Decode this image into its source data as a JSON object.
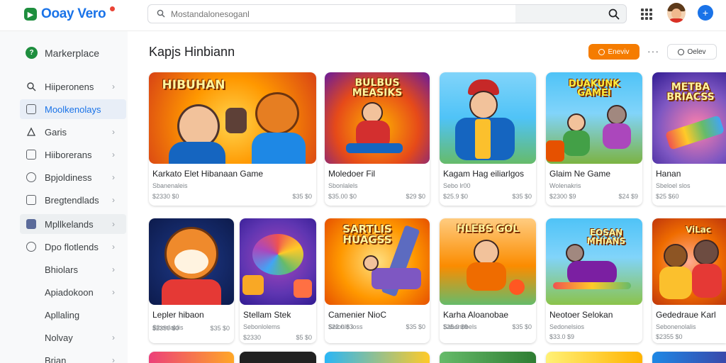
{
  "app": {
    "logo_text": "Ooay Vero",
    "search_placeholder": "Mostandalonesoganl"
  },
  "sidebar": {
    "header": "Markerplace",
    "items": [
      {
        "label": "Hiiperonens",
        "icon": "search-icon",
        "chevron": true
      },
      {
        "label": "Moolkenolays",
        "icon": "marketplace-icon",
        "chevron": false
      },
      {
        "label": "Garis",
        "icon": "games-icon",
        "chevron": true
      },
      {
        "label": "Hiiborerans",
        "icon": "chart-icon",
        "chevron": true
      },
      {
        "label": "Bpjoldiness",
        "icon": "coin-icon",
        "chevron": true
      },
      {
        "label": "Bregtendlads",
        "icon": "list-icon",
        "chevron": true
      },
      {
        "label": "Mpllkelands",
        "icon": "image-icon",
        "chevron": true
      },
      {
        "label": "Dpo flotlends",
        "icon": "shield-icon",
        "chevron": true
      },
      {
        "label": "Bhiolars",
        "icon": "",
        "chevron": true
      },
      {
        "label": "Apiadokoon",
        "icon": "",
        "chevron": true
      },
      {
        "label": "Apllaling",
        "icon": "",
        "chevron": false
      },
      {
        "label": "Nolvay",
        "icon": "",
        "chevron": true
      },
      {
        "label": "Brian",
        "icon": "",
        "chevron": true
      }
    ]
  },
  "main": {
    "title": "Kapjs Hinbiann",
    "primary_chip": "Eneviv",
    "secondary_chip": "Oelev"
  },
  "cards": [
    {
      "art": "HIBUHAN",
      "title": "Karkato Elet Hibanaan Game",
      "sub": "Sbanenaleis",
      "meta_l": "$2330 $0",
      "meta_r": "$35 $0"
    },
    {
      "art": "BULBUS MEASIKS",
      "title": "Moledoer Fil",
      "sub": "Sbonlalels",
      "meta_l": "$35.00 $0",
      "meta_r": "$29 $0"
    },
    {
      "art": "",
      "title": "Kagam Hag eiliarlgos",
      "sub": "Sebo lr00",
      "meta_l": "$25.9 $0",
      "meta_r": "$35 $0"
    },
    {
      "art": "DUAKUNK GAMEI",
      "title": "Glaim Ne Game",
      "sub": "Wolenakris",
      "meta_l": "$2300 $9",
      "meta_r": "$24 $9"
    },
    {
      "art": "METBA BRIACSS",
      "title": "Hanan",
      "sub": "Sbeloel slos",
      "meta_l": "$25 $60",
      "meta_r": ""
    },
    {
      "art": "",
      "title": "Lepler hibaon",
      "sub": "Slbonlaldis",
      "meta_l": "$2350 $0",
      "meta_r": "$35 $0"
    },
    {
      "art": "",
      "title": "Stellam Stek",
      "sub": "Sebonlolems",
      "meta_l": "$2330",
      "meta_r": "$5 $0"
    },
    {
      "art": "SARTLIS HUAGSS",
      "title": "Camenier NioC",
      "sub": "Selonlo loss",
      "meta_l": "$22.0 $3",
      "meta_r": "$35 $0"
    },
    {
      "art": "HLEBS GOL",
      "title": "Karha Aloanobae",
      "sub": "Sabonobels",
      "meta_l": "$25.0 $9",
      "meta_r": "$35 $0"
    },
    {
      "art": "EOSAN MHIANS",
      "title": "Neotoer Selokan",
      "sub": "Sedonelsios",
      "meta_l": "$33.0 $9",
      "meta_r": ""
    },
    {
      "art": "ViLac",
      "title": "Gededraue Karl",
      "sub": "Sebonenolalis",
      "meta_l": "$2355 $0",
      "meta_r": ""
    }
  ],
  "colors": {
    "accent": "#1a73e8",
    "orange": "#f57c00",
    "logo_green": "#1e8e3e"
  }
}
